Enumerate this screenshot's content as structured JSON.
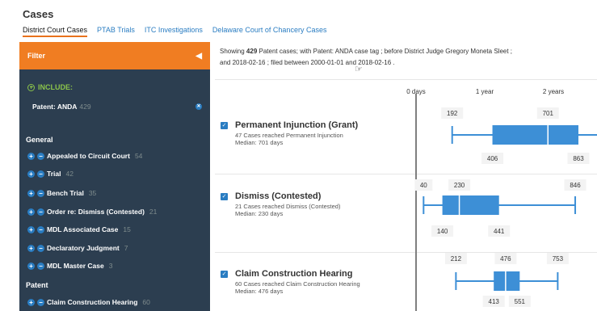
{
  "app": {
    "title": "Cases"
  },
  "tabs": [
    {
      "label": "District Court Cases",
      "active": true
    },
    {
      "label": "PTAB Trials",
      "active": false
    },
    {
      "label": "ITC Investigations",
      "active": false
    },
    {
      "label": "Delaware Court of Chancery Cases",
      "active": false
    }
  ],
  "sidebar": {
    "filter_label": "Filter",
    "include_label": "INCLUDE:",
    "include_item": {
      "label": "Patent: ANDA",
      "count": "429"
    },
    "groups": [
      {
        "header": "General",
        "items": [
          {
            "label": "Appealed to Circuit Court",
            "count": "54"
          },
          {
            "label": "Trial",
            "count": "42"
          },
          {
            "label": "Bench Trial",
            "count": "35"
          },
          {
            "label": "Order re: Dismiss (Contested)",
            "count": "21"
          },
          {
            "label": "MDL Associated Case",
            "count": "15"
          },
          {
            "label": "Declaratory Judgment",
            "count": "7"
          },
          {
            "label": "MDL Master Case",
            "count": "3"
          }
        ]
      },
      {
        "header": "Patent",
        "items": [
          {
            "label": "Claim Construction Hearing",
            "count": "60"
          }
        ]
      }
    ]
  },
  "summary": {
    "prefix": "Showing",
    "count": "429",
    "line1_rest": "Patent  cases;  with Patent: ANDA case tag ;  before District Judge Gregory Moneta Sleet ;",
    "line2": "and 2018-02-16 ;  filed between 2000-01-01 and 2018-02-16 ."
  },
  "axis": {
    "labels": [
      {
        "text": "0 days",
        "days": 0
      },
      {
        "text": "1 year",
        "days": 365
      },
      {
        "text": "2 years",
        "days": 730
      }
    ]
  },
  "rows": [
    {
      "title": "Permanent Injunction (Grant)",
      "sub": "47 Cases reached Permanent Injunction",
      "median_text": "Median: 701 days",
      "checked": true,
      "whisker_low": 192,
      "q1": 406,
      "median": 701,
      "q3": 863,
      "top_labels": [
        "192",
        "701"
      ],
      "bottom_labels": [
        "406",
        "863"
      ]
    },
    {
      "title": "Dismiss (Contested)",
      "sub": "21 Cases reached Dismiss (Contested)",
      "median_text": "Median: 230 days",
      "checked": true,
      "whisker_low": 40,
      "q1": 140,
      "median": 230,
      "q3": 441,
      "whisker_high": 846,
      "top_labels": [
        "40",
        "230",
        "846"
      ],
      "bottom_labels": [
        "140",
        "441"
      ]
    },
    {
      "title": "Claim Construction Hearing",
      "sub": "60 Cases reached Claim Construction Hearing",
      "median_text": "Median: 476 days",
      "checked": true,
      "whisker_low": 212,
      "q1": 413,
      "median": 476,
      "q3": 551,
      "whisker_high": 753,
      "top_labels": [
        "212",
        "476",
        "753"
      ],
      "bottom_labels": [
        "413",
        "551"
      ]
    }
  ],
  "colors": {
    "accent": "#f07d22",
    "sidebar": "#2c3e50",
    "box": "#3d8fd6",
    "link": "#2a7dc2"
  }
}
